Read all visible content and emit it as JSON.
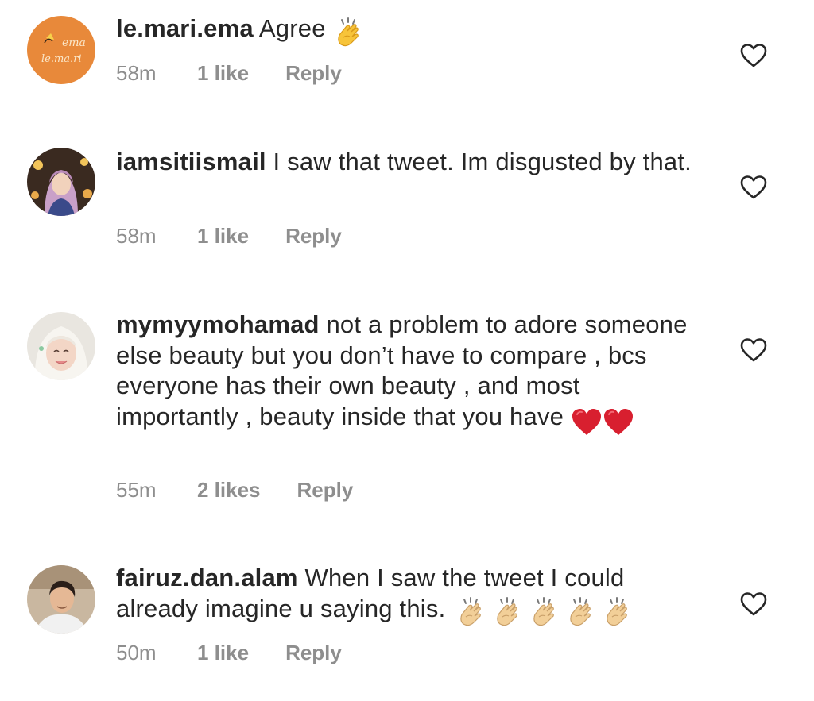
{
  "comments": [
    {
      "username": "le.mari.ema",
      "text": " Agree ",
      "emoji": "clapping-hands",
      "avatar_text_1": "ema",
      "avatar_text_2": "le.ma.ri",
      "time": "58m",
      "likes": "1 like",
      "reply": "Reply"
    },
    {
      "username": "iamsitiismail",
      "text": " I saw that tweet. Im disgusted by that.",
      "time": "58m",
      "likes": "1 like",
      "reply": "Reply"
    },
    {
      "username": "mymyymohamad",
      "text": " not a problem to adore someone else beauty but you don’t have to compare , bcs everyone has their own beauty , and most importantly , beauty inside that you have ",
      "emoji": "red-hearts",
      "time": "55m",
      "likes": "2 likes",
      "reply": "Reply"
    },
    {
      "username": "fairuz.dan.alam",
      "text": " When I saw the tweet I could already imagine u saying this. ",
      "emoji": "clapping-hands",
      "time": "50m",
      "likes": "1 like",
      "reply": "Reply"
    }
  ],
  "colors": {
    "text": "#262626",
    "meta": "#8e8e8e",
    "avatar_orange": "#e8893a",
    "heart_red": "#d81f2f"
  }
}
